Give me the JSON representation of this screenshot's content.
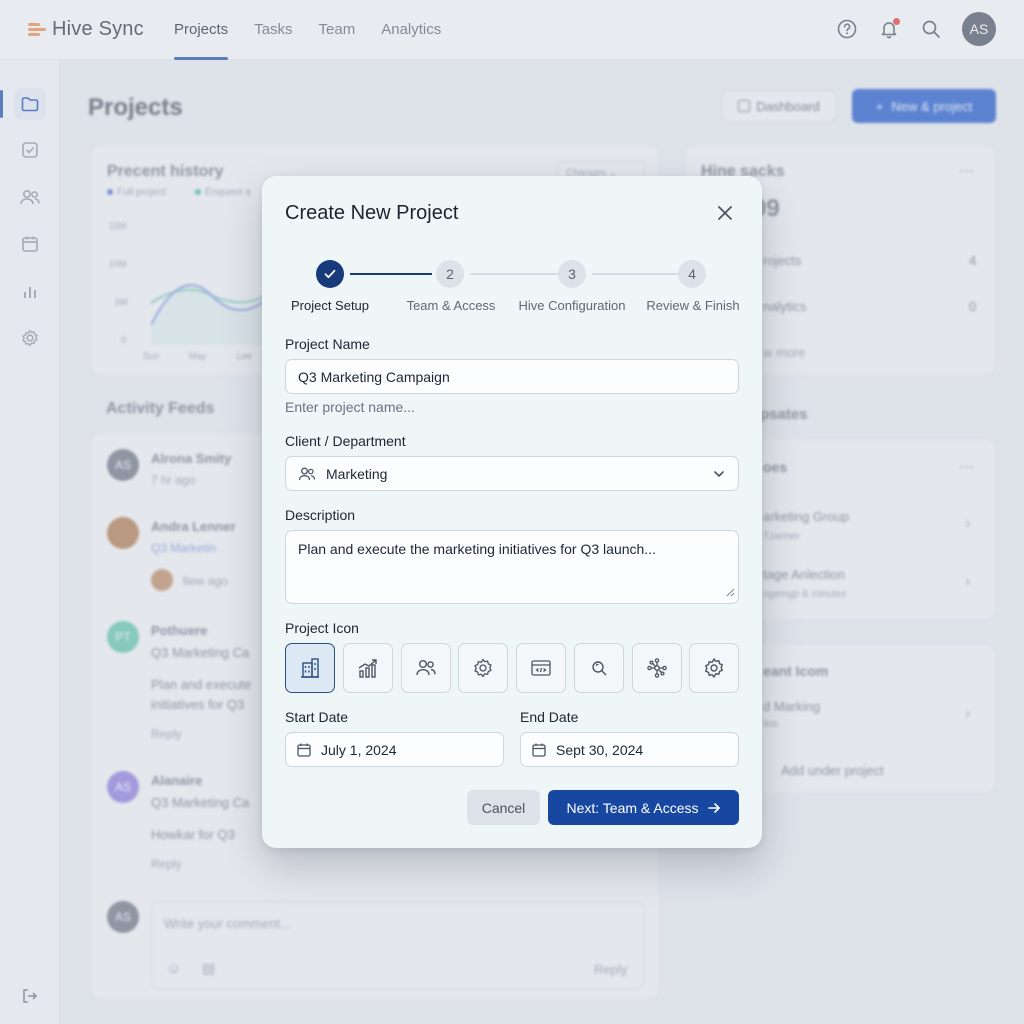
{
  "brand": {
    "name": "Hive Sync"
  },
  "nav": {
    "items": [
      "Projects",
      "Tasks",
      "Team",
      "Analytics"
    ],
    "active": "Projects"
  },
  "user": {
    "initials": "AS"
  },
  "sidebar": {
    "icons": [
      "folder-icon",
      "checkbox-icon",
      "users-icon",
      "calendar-icon",
      "bar-chart-icon",
      "settings-icon",
      "logout-icon"
    ]
  },
  "page": {
    "title": "Projects",
    "dashboard_button": "Dashboard",
    "new_project_button": "New & project"
  },
  "background": {
    "recent_history": {
      "title": "Precent history",
      "legend": [
        "Full project",
        "Enquent a"
      ],
      "dropdown": "Changes",
      "y_ticks": [
        "15M",
        "10M",
        "5M",
        "0"
      ],
      "x_ticks": [
        "Sun",
        "May",
        "Lee"
      ]
    },
    "activity_feeds": {
      "title": "Activity Feeds",
      "items": [
        {
          "initials": "AS",
          "name": "Alrona Smity",
          "meta": "7 hr ago"
        },
        {
          "initials": "",
          "name": "Andra Lenner",
          "meta": "Q3 Marketin"
        },
        {
          "initials": "",
          "name": "",
          "meta": "fiew ago"
        },
        {
          "initials": "PT",
          "name": "Pothuere",
          "meta": "Q3 Marketing Ca",
          "text": [
            "Plan and execute",
            "initiatives for Q3"
          ],
          "action": "Reply"
        },
        {
          "initials": "AS",
          "name": "Alanaire",
          "meta": "Q3 Marketing Ca",
          "text": [
            "Howkar for Q3"
          ],
          "action": "Reply"
        }
      ],
      "comment_placeholder": "Write your comment...",
      "comment_reply": "Reply"
    },
    "right_card": {
      "title": "Hine sacks",
      "big_number": "09",
      "rows": [
        {
          "label": "rojects",
          "value": "4"
        },
        {
          "label": "nalytics",
          "value": "0"
        }
      ],
      "more": "w more"
    },
    "updates": {
      "title": "psates",
      "card_title": "oes",
      "items": [
        {
          "title": "arketing Group",
          "sub": "Tzanner"
        },
        {
          "title": "tage Anlection",
          "sub": "ngemgp & minutes"
        }
      ]
    },
    "recent_icons": {
      "title": "eant Icom",
      "item": "d Marking",
      "sub": "ikts",
      "add": "Add under project"
    }
  },
  "modal": {
    "title": "Create New Project",
    "steps": [
      {
        "number": "1",
        "label": "Project Setup",
        "status": "done"
      },
      {
        "number": "2",
        "label": "Team & Access",
        "status": "todo"
      },
      {
        "number": "3",
        "label": "Hive Configuration",
        "status": "todo"
      },
      {
        "number": "4",
        "label": "Review & Finish",
        "status": "todo"
      }
    ],
    "project_name": {
      "label": "Project Name",
      "value": "Q3 Marketing Campaign",
      "helper": "Enter project name..."
    },
    "client": {
      "label": "Client / Department",
      "value": "Marketing"
    },
    "description": {
      "label": "Description",
      "value": "Plan and execute the marketing initiatives for Q3 launch..."
    },
    "project_icon": {
      "label": "Project Icon",
      "options": [
        "building-icon",
        "growth-chart-icon",
        "team-icon",
        "gear-network-icon",
        "code-window-icon",
        "search-icon",
        "network-icon",
        "settings-icon"
      ],
      "selected": "building-icon"
    },
    "start_date": {
      "label": "Start Date",
      "value": "July 1, 2024"
    },
    "end_date": {
      "label": "End Date",
      "value": "Sept 30, 2024"
    },
    "cancel_label": "Cancel",
    "next_label": "Next: Team & Access"
  },
  "colors": {
    "primary": "#1747a0",
    "step_done": "#163a7a",
    "accent_orange": "#e3894c",
    "notification": "#e03a3a"
  }
}
